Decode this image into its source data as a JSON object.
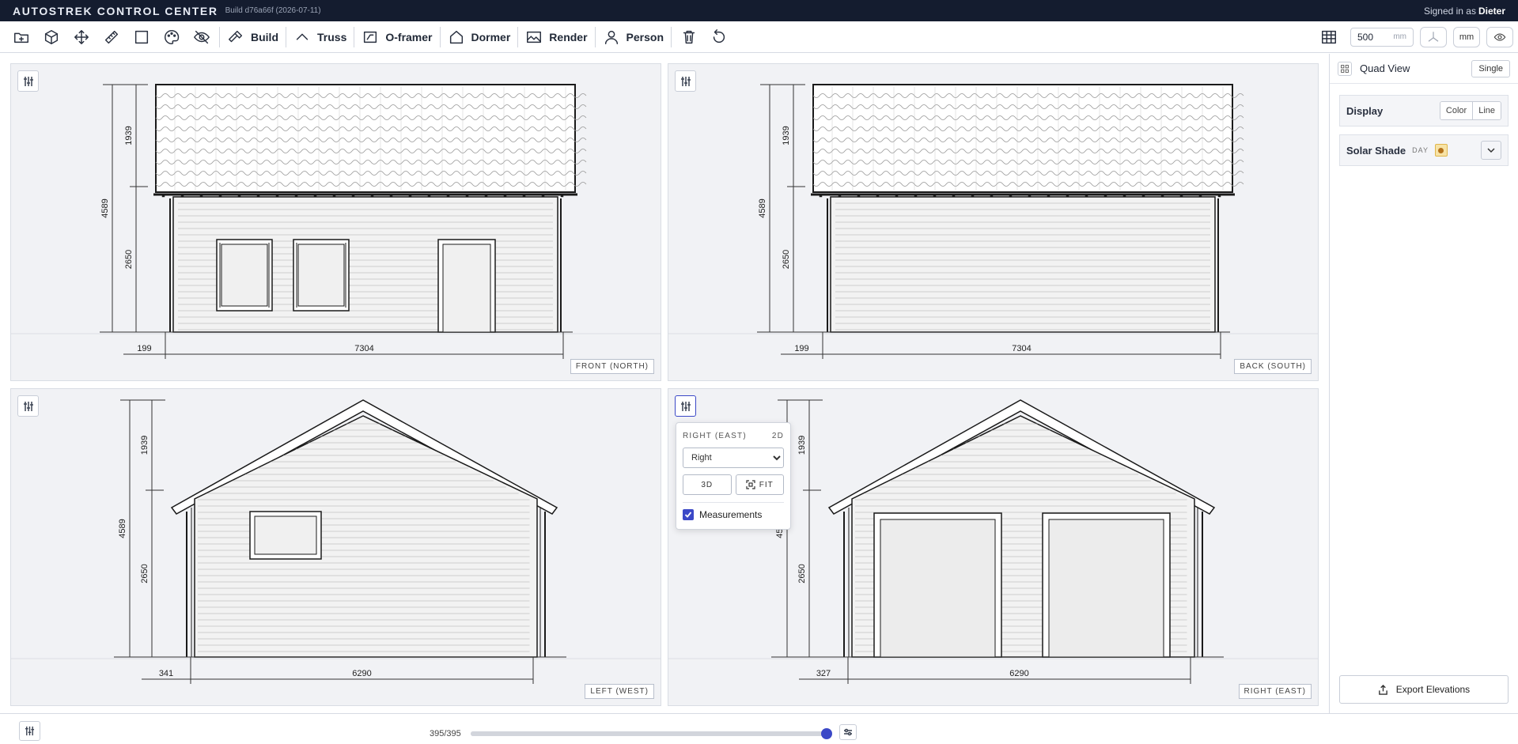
{
  "header": {
    "brand": "AUTOSTREK CONTROL CENTER",
    "build": "Build d76a66f (2026-07-11)",
    "signed_prefix": "Signed in as",
    "user": "Dieter"
  },
  "toolbar": {
    "icons": [
      "new-folder-icon",
      "cube-icon",
      "move-icon",
      "ruler-icon",
      "square-icon",
      "palette-icon",
      "hide-icon"
    ],
    "tools": [
      {
        "label": "Build",
        "icon": "hammer-icon"
      },
      {
        "label": "Truss",
        "icon": "roof-icon"
      },
      {
        "label": "O-framer",
        "icon": "frame-icon"
      },
      {
        "label": "Dormer",
        "icon": "house-icon"
      },
      {
        "label": "Render",
        "icon": "image-icon"
      },
      {
        "label": "Person",
        "icon": "person-icon"
      }
    ],
    "grid_value": "500",
    "grid_unit": "mm",
    "unit_label": "mm"
  },
  "views": [
    {
      "label": "FRONT (NORTH)",
      "dims": {
        "total": "4589",
        "roof": "1939",
        "wall": "2650",
        "offset": "199",
        "length": "7304"
      }
    },
    {
      "label": "BACK (SOUTH)",
      "dims": {
        "total": "4589",
        "roof": "1939",
        "wall": "2650",
        "offset": "199",
        "length": "7304"
      }
    },
    {
      "label": "LEFT (WEST)",
      "dims": {
        "total": "4589",
        "roof": "1939",
        "wall": "2650",
        "offset": "341",
        "length": "6290"
      }
    },
    {
      "label": "RIGHT (EAST)",
      "dims": {
        "total": "4589",
        "roof": "1939",
        "wall": "2650",
        "offset": "327",
        "length": "6290"
      }
    }
  ],
  "popup": {
    "title": "RIGHT (EAST)",
    "mode": "2D",
    "select_value": "Right",
    "btn_3d": "3D",
    "btn_fit": "FIT",
    "measurements_label": "Measurements",
    "measurements_checked": true
  },
  "sidebar": {
    "view_label": "Quad View",
    "single_label": "Single",
    "display_label": "Display",
    "display_options": [
      "Color",
      "Line"
    ],
    "solar_label": "Solar Shade",
    "solar_mode": "DAY",
    "export_label": "Export Elevations"
  },
  "bottom": {
    "frame_text": "395/395",
    "progress": 1.0
  },
  "colors": {
    "accent": "#3b48c7",
    "topbar": "#141c2f"
  }
}
